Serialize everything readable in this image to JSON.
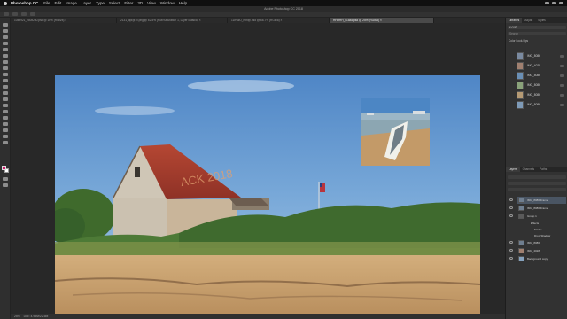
{
  "menubar": {
    "app_name": "Photoshop CC",
    "items": [
      "File",
      "Edit",
      "Image",
      "Layer",
      "Type",
      "Select",
      "Filter",
      "3D",
      "View",
      "Window",
      "Help"
    ]
  },
  "title": "Adobe Photoshop CC 2018",
  "tabs": [
    {
      "label": "1049921_280x280.psd @ 16% (RGB/8) ×"
    },
    {
      "label": "2131_dpi@1x.png @ 62.5% (Hue/Saturation 1, Layer Mask/8) ×"
    },
    {
      "label": "1DHWD_nph@.psd @ 66.7% (RGB/8) ×"
    },
    {
      "label": "HHHHH_01884.psd @ 25% (RGB/8) ×"
    }
  ],
  "photo": {
    "roof_text": "ACK 2018"
  },
  "statusbar": {
    "zoom": "25%",
    "doc": "Doc: 4.95M/22.6M"
  },
  "panels": {
    "tabs": [
      "Libraries",
      "Adjust",
      "Styles"
    ],
    "library_name": "LYKIR",
    "search_placeholder": "Search",
    "section_label": "Color Look-Ups",
    "library_items": [
      {
        "name": "IMG_8086"
      },
      {
        "name": "IMG_4028"
      },
      {
        "name": "IMG_8086"
      },
      {
        "name": "IMG_8086"
      },
      {
        "name": "IMG_8086"
      },
      {
        "name": "IMG_8086"
      }
    ],
    "layers_tabs": [
      "Layers",
      "Channels",
      "Paths"
    ],
    "layers": [
      {
        "name": "IMG_8086 Frame"
      },
      {
        "name": "IMG_8086 Frame"
      },
      {
        "name": "Group 1"
      },
      {
        "name": "Effects"
      },
      {
        "name": "Stroke"
      },
      {
        "name": "Drop Shadow"
      },
      {
        "name": "IMG_8086"
      },
      {
        "name": "IMG_4028"
      },
      {
        "name": "Background copy"
      }
    ]
  },
  "colors": {
    "foreground": "#cc1a6b",
    "background": "#ffffff",
    "roof": "#a23a2c"
  }
}
